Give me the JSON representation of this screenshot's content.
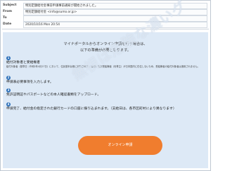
{
  "email": {
    "fields": [
      {
        "label": "Subject",
        "value": "特別定額給付金事前申請事前通知が開始されました。"
      },
      {
        "label": "From",
        "value": "特別定額給付金 <info@sumo.or.jp>"
      },
      {
        "label": "To",
        "value": ""
      },
      {
        "label": "Date",
        "value": "2020/10/16 Mon 20:54"
      }
    ]
  },
  "body": {
    "intro_lines": [
      "マイナポータルからオンライン申請を行う場合は、",
      "以下の準備が必要となります。"
    ],
    "steps": [
      {
        "num": "1",
        "title": "給付対象者と受給権者",
        "desc": "給付対象者（基準日（令和2年4月27日）において、住民基本台帳に記録されている者）及び受給権者（世帯主）が日本国内に在住しないため、受給権者の給付対象者は適用されません。"
      },
      {
        "num": "2",
        "title": "申請表必要事項を入力します。",
        "desc": ""
      },
      {
        "num": "3",
        "title": "免許証明証やパスポートなどの本人確認書類をアップロード。",
        "desc": ""
      },
      {
        "num": "4",
        "title": "申請完了、給付金の指定された銀行カードの口座に振り込まれます。（支給日は、各市区町村により異なります）",
        "desc": ""
      }
    ],
    "cta_label": "オンライン申請"
  },
  "watermark": "無視は危険な濃いグ",
  "colors": {
    "body_background": "#dde9f6",
    "cta": "#f07d2e",
    "step_badge": "#2b6fb8"
  }
}
